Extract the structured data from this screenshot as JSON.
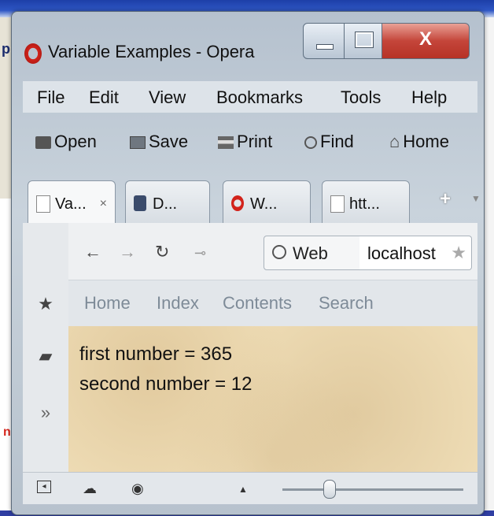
{
  "window": {
    "title": "Variable Examples - Opera",
    "close_label": "X"
  },
  "menu": [
    "File",
    "Edit",
    "View",
    "Bookmarks",
    "Tools",
    "Help"
  ],
  "toolbar": {
    "open": "Open",
    "save": "Save",
    "print": "Print",
    "find": "Find",
    "home": "Home"
  },
  "tabs": [
    {
      "label": "Va...",
      "close": "×"
    },
    {
      "label": "D..."
    },
    {
      "label": "W..."
    },
    {
      "label": "htt..."
    }
  ],
  "tab_add": "+",
  "address": {
    "web_label": "Web",
    "url": "localhost"
  },
  "bookmarks": [
    "Home",
    "Index",
    "Contents",
    "Search"
  ],
  "page": {
    "line1": "first number = 365",
    "line2": "second number = 12"
  },
  "icons": {
    "back": "back-arrow-icon",
    "forward": "forward-arrow-icon",
    "reload": "reload-icon",
    "key": "key-icon",
    "star": "star-icon"
  },
  "colors": {
    "close_button": "#c4453a",
    "page_background": "#eedcb5",
    "opera_red": "#d2231b"
  }
}
